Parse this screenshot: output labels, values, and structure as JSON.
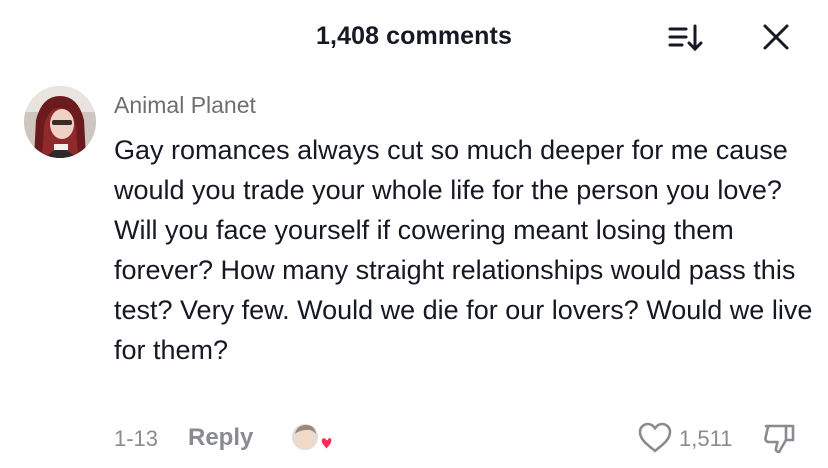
{
  "header": {
    "title": "1,408 comments",
    "sort_icon": "sort-list-icon",
    "close_icon": "close-icon"
  },
  "comment": {
    "author": "Animal Planet",
    "avatar_icon": "user-avatar",
    "text": "Gay romances always cut so much deeper for me cause would you trade your whole life for the person you love? Will you face yourself if cowering meant losing them forever? How many straight relationships would pass this test? Very few. Would we die for our lovers? Would we live for them?",
    "date": "1-13",
    "reply_label": "Reply",
    "likes": "1,511",
    "like_icon": "heart-outline-icon",
    "dislike_icon": "thumbs-down-icon",
    "creator_liked_icon": "creator-liked-badge"
  },
  "colors": {
    "text_primary": "#161823",
    "text_secondary": "#8a8b91",
    "author": "#6f6f72",
    "heart_accent": "#fe2c55"
  }
}
